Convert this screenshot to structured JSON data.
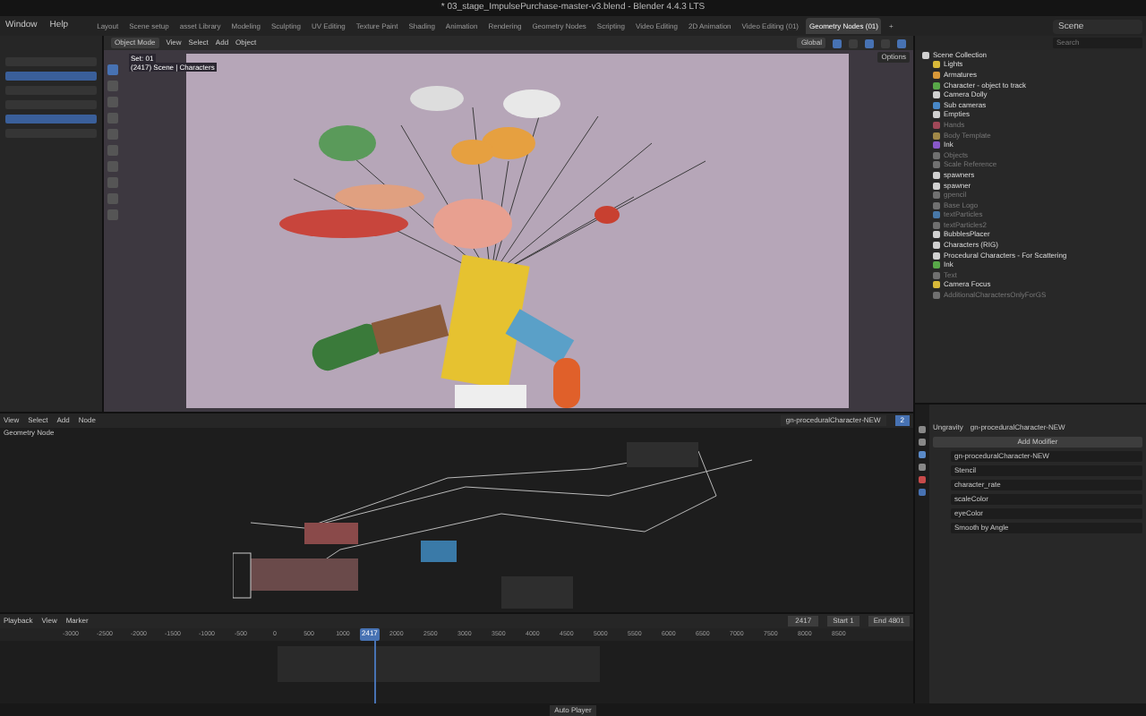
{
  "window": {
    "title": "* 03_stage_ImpulsePurchase-master-v3.blend - Blender 4.4.3 LTS"
  },
  "menus": [
    "Window",
    "Help"
  ],
  "workspaces": [
    {
      "label": "Layout",
      "selected": false
    },
    {
      "label": "Scene setup",
      "selected": false
    },
    {
      "label": "asset Library",
      "selected": false
    },
    {
      "label": "Modeling",
      "selected": false
    },
    {
      "label": "Sculpting",
      "selected": false
    },
    {
      "label": "UV Editing",
      "selected": false
    },
    {
      "label": "Texture Paint",
      "selected": false
    },
    {
      "label": "Shading",
      "selected": false
    },
    {
      "label": "Animation",
      "selected": false
    },
    {
      "label": "Rendering",
      "selected": false
    },
    {
      "label": "Geometry Nodes",
      "selected": false
    },
    {
      "label": "Scripting",
      "selected": false
    },
    {
      "label": "Video Editing",
      "selected": false
    },
    {
      "label": "2D Animation",
      "selected": false
    },
    {
      "label": "Video Editing (01)",
      "selected": false
    },
    {
      "label": "Geometry Nodes (01)",
      "selected": true
    },
    {
      "label": "+",
      "selected": false
    }
  ],
  "scene": "Scene",
  "viewport": {
    "mode": "Object Mode",
    "menus": [
      "View",
      "Select",
      "Add",
      "Object"
    ],
    "transform": "Global",
    "options": "Options",
    "overlay": [
      "Set: 01",
      "(2417) Scene | Characters"
    ]
  },
  "outliner": {
    "search_placeholder": "Search",
    "items": [
      {
        "label": "Scene Collection",
        "color": "#d0d0d0",
        "dimmed": false,
        "children": [
          {
            "label": "Lights",
            "color": "#d8b838",
            "dimmed": false
          },
          {
            "label": "Armatures",
            "color": "#d89838",
            "dimmed": false
          },
          {
            "label": "Character - object to track",
            "color": "#58a848",
            "dimmed": false
          },
          {
            "label": "Camera Dolly",
            "color": "#d0d0d0",
            "dimmed": false
          },
          {
            "label": "Sub cameras",
            "color": "#4888c8",
            "dimmed": false
          },
          {
            "label": "Empties",
            "color": "#d0d0d0",
            "dimmed": false
          },
          {
            "label": "Hands",
            "color": "#a04858",
            "dimmed": true
          },
          {
            "label": "Body Template",
            "color": "#a08848",
            "dimmed": true
          },
          {
            "label": "Ink",
            "color": "#8858c8",
            "dimmed": false
          },
          {
            "label": "Objects",
            "color": "#707070",
            "dimmed": true
          },
          {
            "label": "Scale Reference",
            "color": "#707070",
            "dimmed": true
          },
          {
            "label": "spawners",
            "color": "#d0d0d0",
            "dimmed": false
          },
          {
            "label": "spawner",
            "color": "#d0d0d0",
            "dimmed": false
          },
          {
            "label": "gpencil",
            "color": "#707070",
            "dimmed": true
          },
          {
            "label": "Base Logo",
            "color": "#707070",
            "dimmed": true
          },
          {
            "label": "textParticles",
            "color": "#4878a8",
            "dimmed": true
          },
          {
            "label": "textParticles2",
            "color": "#707070",
            "dimmed": true
          },
          {
            "label": "BubblesPlacer",
            "color": "#d0d0d0",
            "dimmed": false
          },
          {
            "label": "Characters (RIG)",
            "color": "#d0d0d0",
            "dimmed": false
          },
          {
            "label": "Procedural Characters - For Scattering",
            "color": "#d0d0d0",
            "dimmed": false
          },
          {
            "label": "Ink",
            "color": "#58a848",
            "dimmed": false
          },
          {
            "label": "Text",
            "color": "#707070",
            "dimmed": true
          },
          {
            "label": "Camera Focus",
            "color": "#d8b838",
            "dimmed": false
          },
          {
            "label": "AdditionalCharactersOnlyForGS",
            "color": "#707070",
            "dimmed": true
          }
        ]
      }
    ]
  },
  "node_editor": {
    "menus": [
      "View",
      "Select",
      "Add",
      "Node"
    ],
    "panel": "Geometry Node",
    "tree": "gn-proceduralCharacter-NEW",
    "users": "2"
  },
  "properties": {
    "breadcrumb": [
      "Ungravity",
      "gn-proceduralCharacter-NEW"
    ],
    "add_modifier": "Add Modifier",
    "rows": [
      {
        "label": "gn-proceduralCharacter-NEW"
      },
      {
        "label": "Stencil"
      },
      {
        "label": "character_rate"
      },
      {
        "label": "scaleColor"
      },
      {
        "label": "eyeColor"
      },
      {
        "label": "Smooth by Angle"
      }
    ]
  },
  "timeline": {
    "menus": [
      "Playback",
      "View",
      "Marker"
    ],
    "current": "2417",
    "playhead_frame": "2417",
    "start_label": "Start",
    "start": "1",
    "end_label": "End",
    "end": "4801",
    "ticks": [
      "-3000",
      "-2500",
      "-2000",
      "-1500",
      "-1000",
      "-500",
      "0",
      "500",
      "1000",
      "2000",
      "2500",
      "3000",
      "3500",
      "4000",
      "4500",
      "5000",
      "5500",
      "6000",
      "6500",
      "7000",
      "7500",
      "8000",
      "8500"
    ]
  },
  "status": "Auto Player"
}
